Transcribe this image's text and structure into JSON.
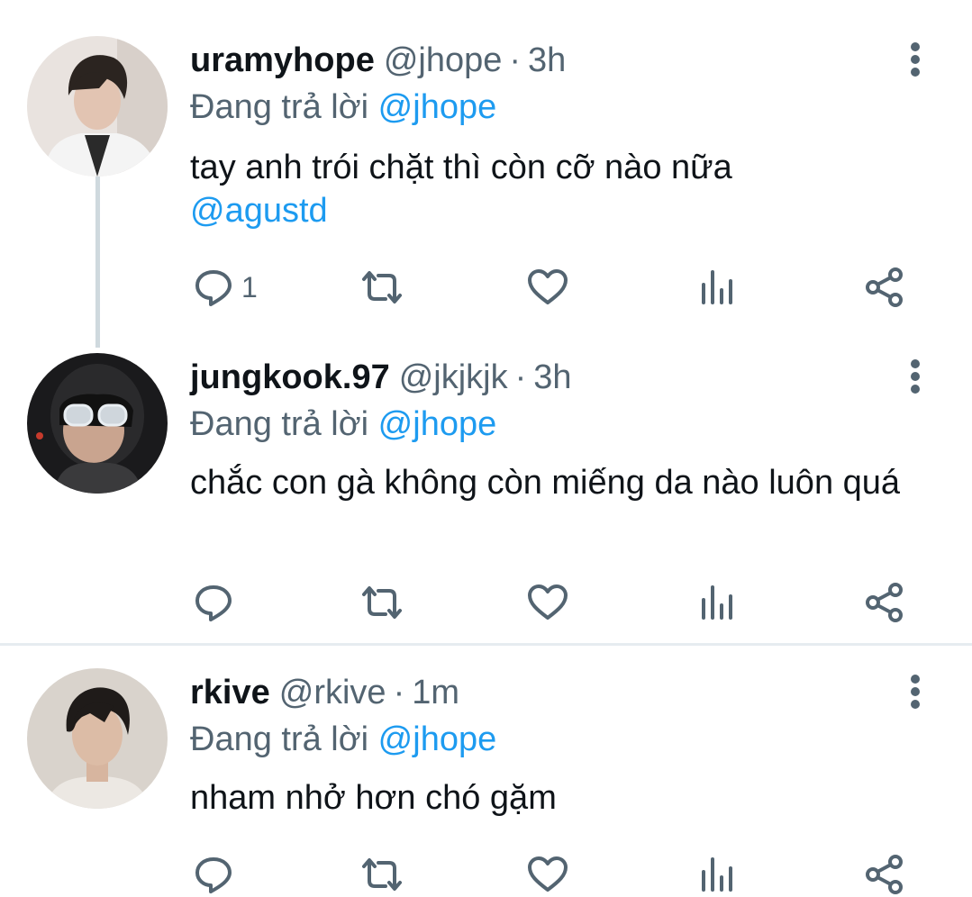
{
  "colors": {
    "accent": "#1d9bf0",
    "secondary_text": "#536471",
    "primary_text": "#0f1419",
    "icon": "#536471"
  },
  "tweets": [
    {
      "display_name": "uramyhope",
      "handle": "@jhope",
      "separator": "·",
      "time": "3h",
      "replying_prefix": "Đang trả lời",
      "replying_to": "@jhope",
      "text": "tay anh trói chặt thì còn cỡ nào nữa",
      "text_mention": "@agustd",
      "reply_count": "1",
      "avatar_icon": "profile-photo",
      "actions": [
        "reply-icon",
        "retweet-icon",
        "like-icon",
        "analytics-icon",
        "share-icon"
      ]
    },
    {
      "display_name": "jungkook.97",
      "handle": "@jkjkjk",
      "separator": "·",
      "time": "3h",
      "replying_prefix": "Đang trả lời",
      "replying_to": "@jhope",
      "text": "chắc con gà không còn miếng da nào luôn quá",
      "reply_count": "",
      "avatar_icon": "profile-photo"
    },
    {
      "display_name": "rkive",
      "handle": "@rkive",
      "separator": "·",
      "time": "1m",
      "replying_prefix": "Đang trả lời",
      "replying_to": "@jhope",
      "text": "nham nhở hơn chó gặm",
      "reply_count": "",
      "avatar_icon": "profile-photo"
    }
  ]
}
